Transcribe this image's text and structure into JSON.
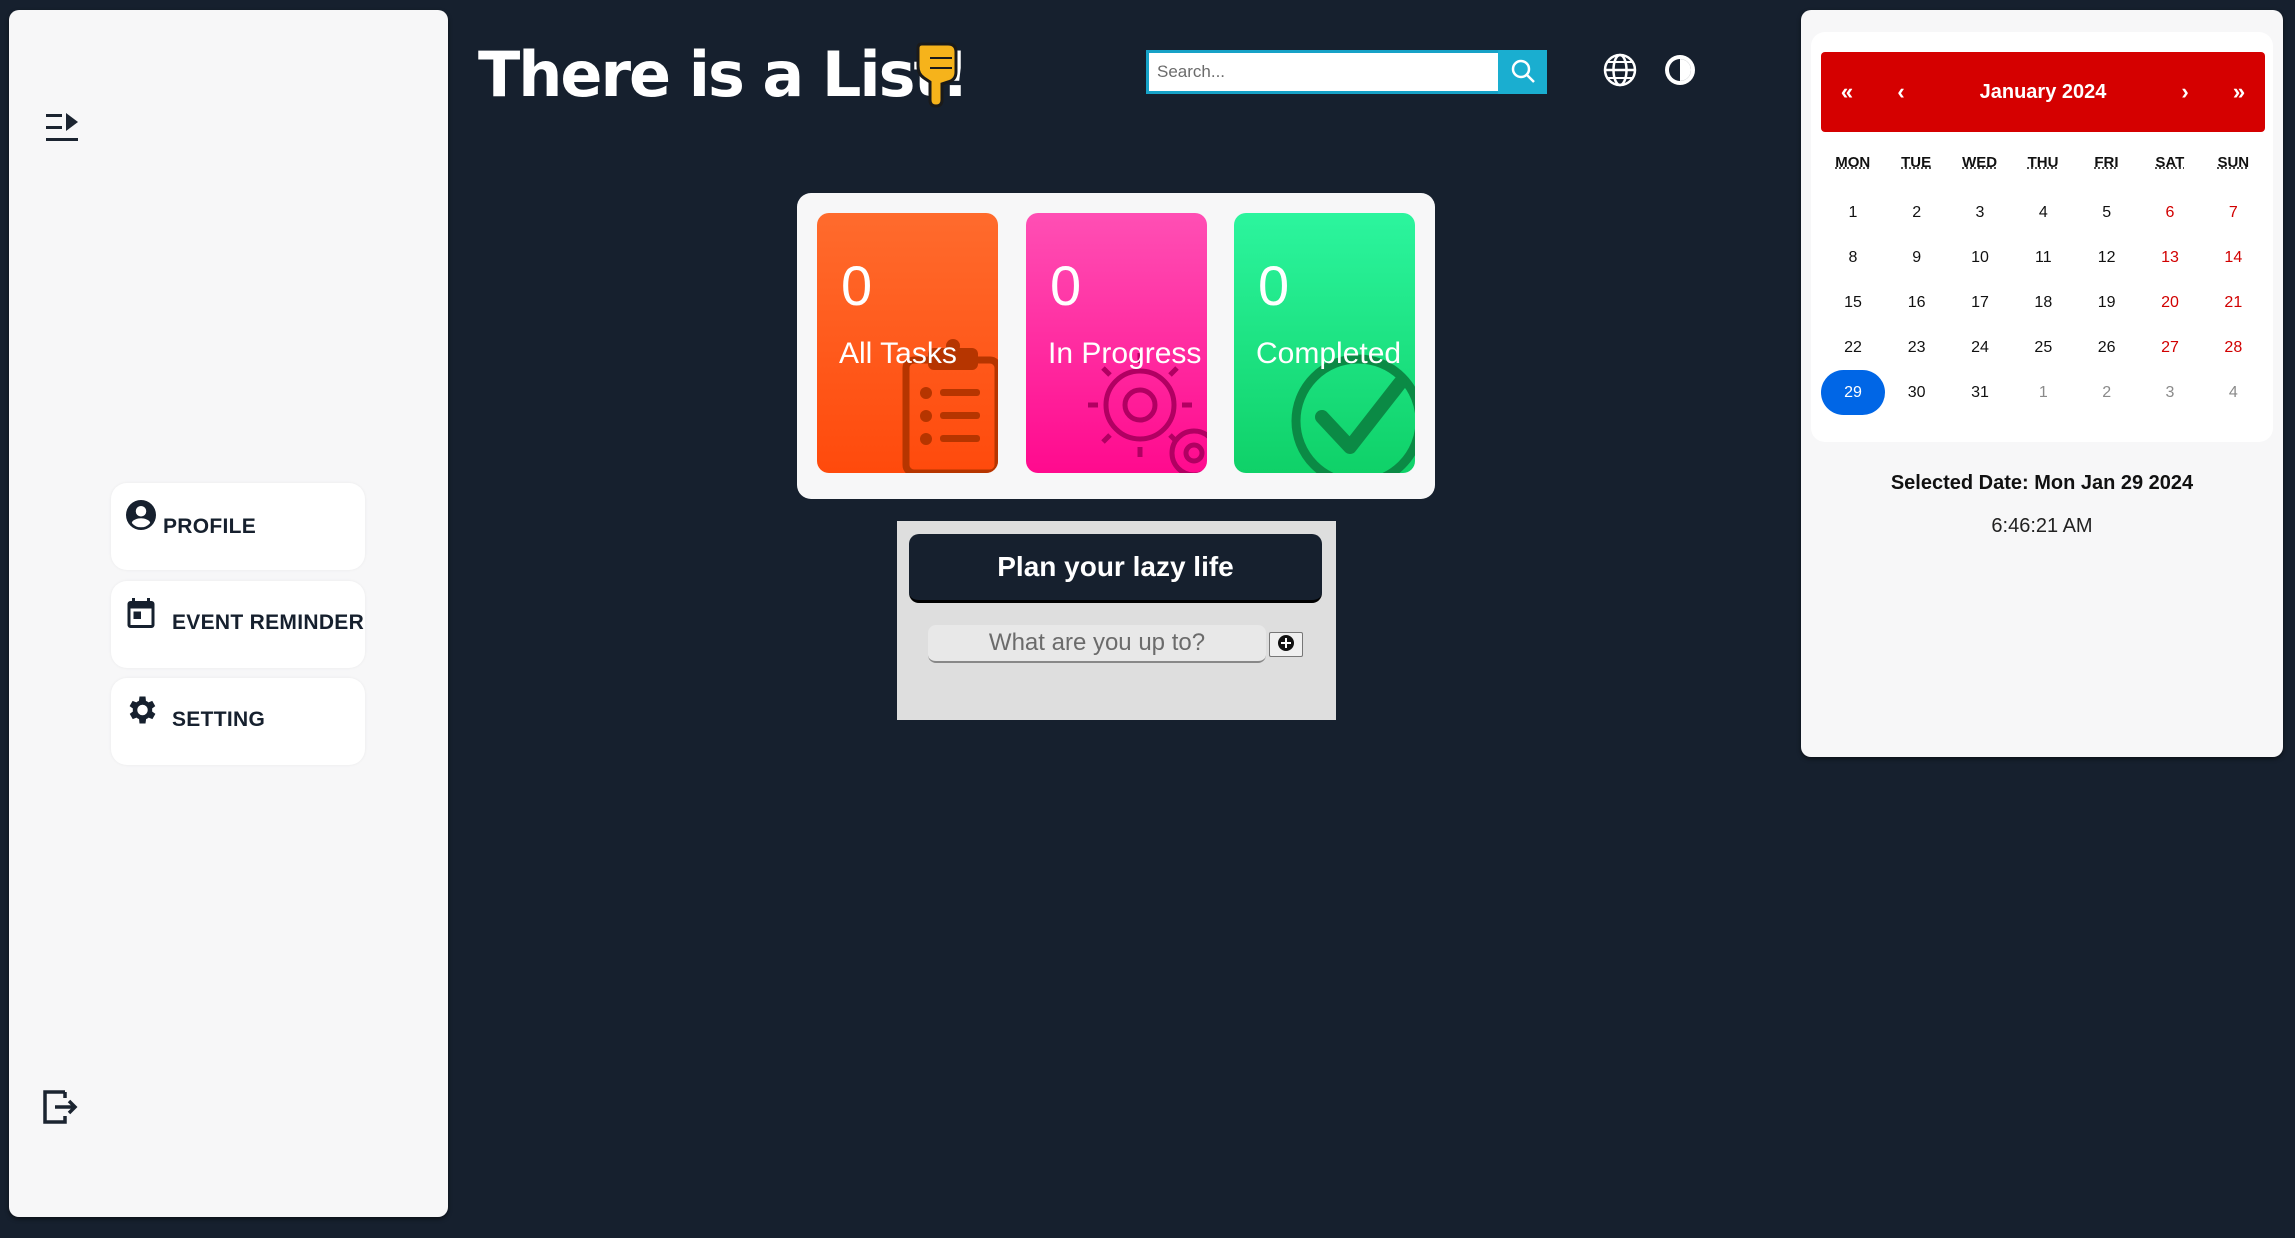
{
  "header": {
    "title": "There is a List!",
    "title_emoji": "pointing-down-hand",
    "search_placeholder": "Search..."
  },
  "sidebar": {
    "items": [
      {
        "label": "PROFILE",
        "icon": "account-circle-icon"
      },
      {
        "label": "EVENT REMINDER",
        "icon": "calendar-icon"
      },
      {
        "label": "SETTING",
        "icon": "gear-icon"
      }
    ]
  },
  "stats": [
    {
      "count": "0",
      "label": "All Tasks",
      "color": "#ff5a1a",
      "icon": "clipboard-list-icon"
    },
    {
      "count": "0",
      "label": "In Progress",
      "color": "#ff1a96",
      "icon": "gears-icon"
    },
    {
      "count": "0",
      "label": "Completed",
      "color": "#14d873",
      "icon": "check-circle-icon"
    }
  ],
  "planner": {
    "title": "Plan your lazy life",
    "input_placeholder": "What are you up to?"
  },
  "calendar": {
    "nav_first": "«",
    "nav_prev": "‹",
    "nav_next": "›",
    "nav_last": "»",
    "month_label": "January 2024",
    "weekdays": [
      "MON",
      "TUE",
      "WED",
      "THU",
      "FRI",
      "SAT",
      "SUN"
    ],
    "days": [
      {
        "d": "1"
      },
      {
        "d": "2"
      },
      {
        "d": "3"
      },
      {
        "d": "4"
      },
      {
        "d": "5"
      },
      {
        "d": "6",
        "w": true
      },
      {
        "d": "7",
        "w": true
      },
      {
        "d": "8"
      },
      {
        "d": "9"
      },
      {
        "d": "10"
      },
      {
        "d": "11"
      },
      {
        "d": "12"
      },
      {
        "d": "13",
        "w": true
      },
      {
        "d": "14",
        "w": true
      },
      {
        "d": "15"
      },
      {
        "d": "16"
      },
      {
        "d": "17"
      },
      {
        "d": "18"
      },
      {
        "d": "19"
      },
      {
        "d": "20",
        "w": true
      },
      {
        "d": "21",
        "w": true
      },
      {
        "d": "22"
      },
      {
        "d": "23"
      },
      {
        "d": "24"
      },
      {
        "d": "25"
      },
      {
        "d": "26"
      },
      {
        "d": "27",
        "w": true
      },
      {
        "d": "28",
        "w": true
      },
      {
        "d": "29",
        "sel": true
      },
      {
        "d": "30"
      },
      {
        "d": "31"
      },
      {
        "d": "1",
        "o": true
      },
      {
        "d": "2",
        "o": true
      },
      {
        "d": "3",
        "o": true
      },
      {
        "d": "4",
        "o": true
      }
    ],
    "accent_color": "#d50000",
    "selected_color": "#0066e6",
    "weekend_color": "#d10000"
  },
  "selected_date": "Selected Date: Mon Jan 29 2024",
  "clock": "6:46:21 AM"
}
